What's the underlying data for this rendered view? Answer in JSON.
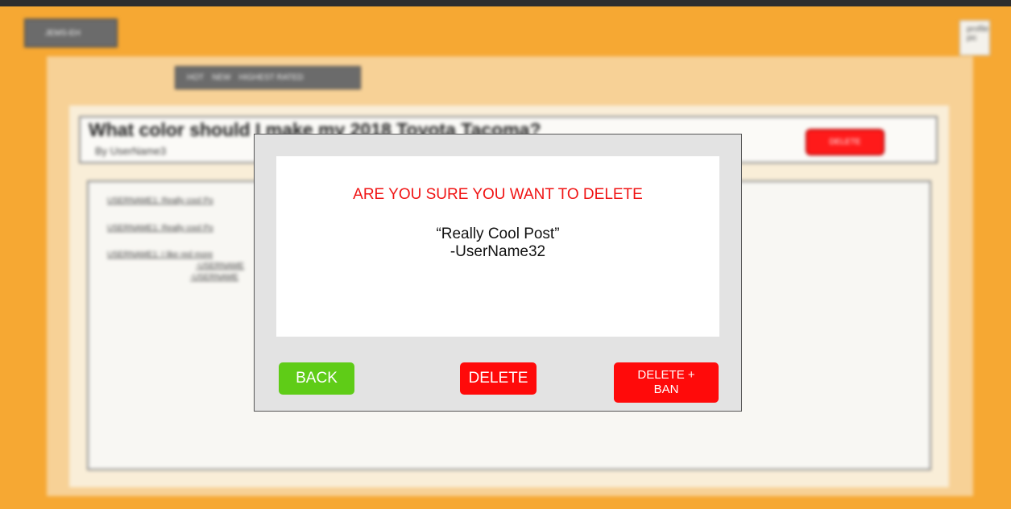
{
  "header": {
    "logo_label": "JEMS-EH",
    "profile_label": "profile pic"
  },
  "sort_tabs": [
    "HOT",
    "NEW",
    "HIGHEST RATED"
  ],
  "post": {
    "title": "What color should I make my 2018 Toyota Tacoma?",
    "author": "By UserName3",
    "delete_label": "DELETE"
  },
  "comments": [
    "USERNAME1: Really cool Po",
    "USERNAME1: Really cool Po",
    "USERNAME1: I like red more",
    "-USERNAME",
    "-USERNAME"
  ],
  "modal": {
    "heading": "ARE YOU SURE YOU WANT TO DELETE",
    "quote": "“Really Cool Post”",
    "quote_author": "-UserName32",
    "back_label": "BACK",
    "delete_label": "DELETE",
    "delete_ban_label_1": "DELETE +",
    "delete_ban_label_2": "BAN"
  },
  "colors": {
    "page_bg": "#f6a833",
    "danger": "#ff0a0a",
    "success": "#5fcc17",
    "heading_red": "#f01414"
  }
}
